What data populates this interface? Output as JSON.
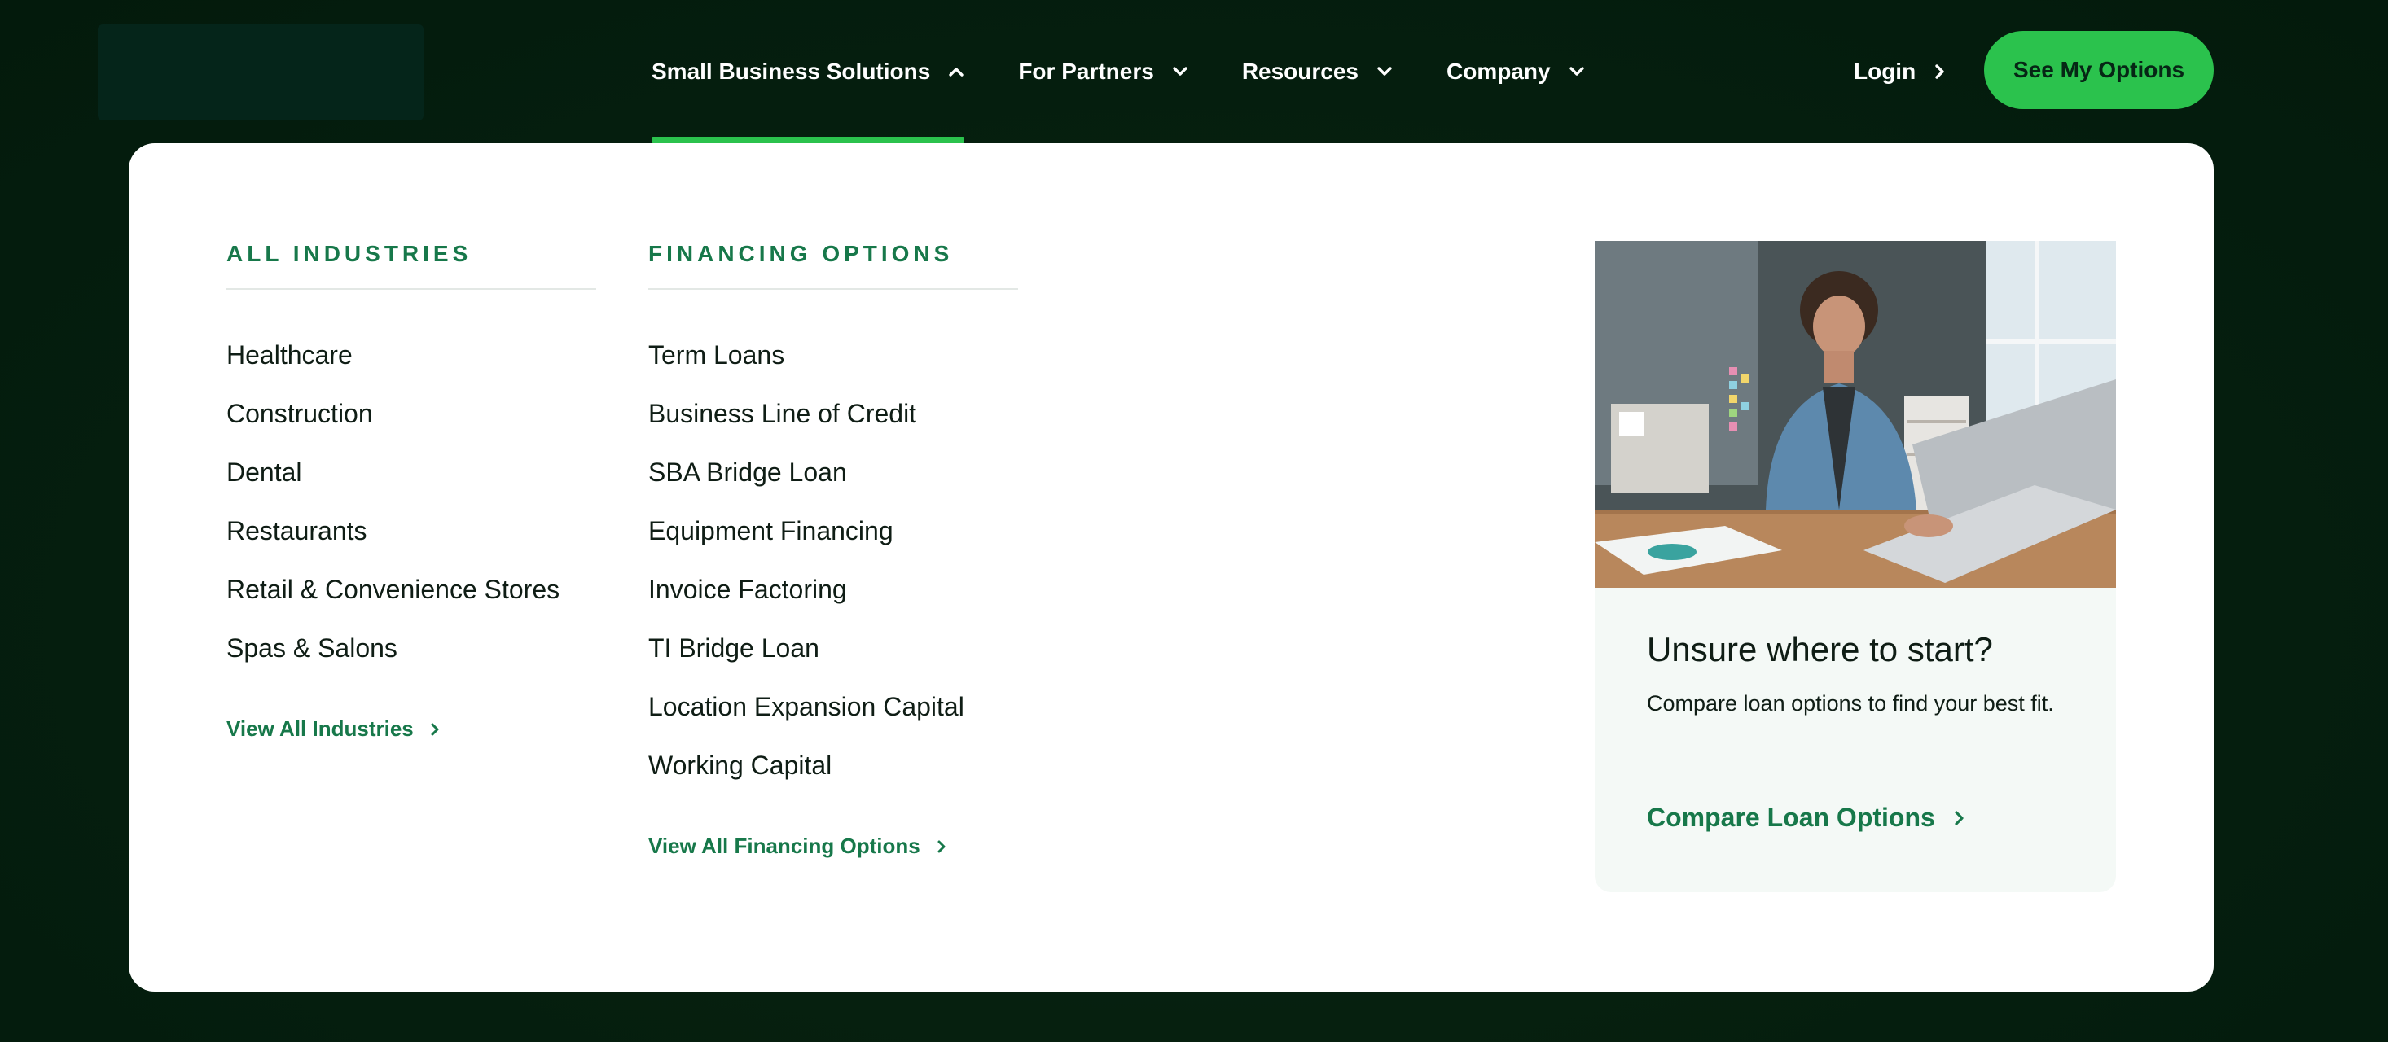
{
  "nav": {
    "items": [
      {
        "label": "Small Business Solutions",
        "active": true,
        "chevron": "chevron-up-icon"
      },
      {
        "label": "For Partners",
        "active": false,
        "chevron": "chevron-down-icon"
      },
      {
        "label": "Resources",
        "active": false,
        "chevron": "chevron-down-icon"
      },
      {
        "label": "Company",
        "active": false,
        "chevron": "chevron-down-icon"
      }
    ],
    "login_label": "Login",
    "cta_label": "See My Options"
  },
  "dropdown": {
    "industries": {
      "heading": "ALL INDUSTRIES",
      "items": [
        "Healthcare",
        "Construction",
        "Dental",
        "Restaurants",
        "Retail & Convenience Stores",
        "Spas & Salons"
      ],
      "view_all": "View All Industries"
    },
    "financing": {
      "heading": "FINANCING OPTIONS",
      "items": [
        "Term Loans",
        "Business Line of Credit",
        "SBA Bridge Loan",
        "Equipment Financing",
        "Invoice Factoring",
        "TI Bridge Loan",
        "Location Expansion Capital",
        "Working Capital"
      ],
      "view_all": "View All Financing Options"
    },
    "promo": {
      "title": "Unsure where to start?",
      "description": "Compare loan options to find your best fit.",
      "link": "Compare Loan Options"
    }
  },
  "colors": {
    "accent_green": "#2bc24d",
    "link_green": "#17784a",
    "background": "#031a0c",
    "panel": "#ffffff"
  }
}
